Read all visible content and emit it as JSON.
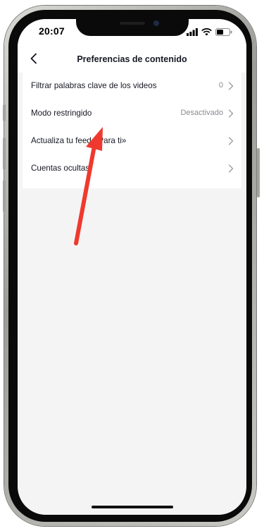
{
  "status_bar": {
    "time": "20:07",
    "icons": [
      "signal-bars-icon",
      "wifi-icon",
      "battery-icon"
    ]
  },
  "nav": {
    "back_icon": "chevron-left-icon",
    "title": "Preferencias de contenido"
  },
  "settings": {
    "items": [
      {
        "label": "Filtrar palabras clave de los videos",
        "value": "0"
      },
      {
        "label": "Modo restringido",
        "value": "Desactivado"
      },
      {
        "label": "Actualiza tu feed «Para ti»",
        "value": ""
      },
      {
        "label": "Cuentas ocultas",
        "value": ""
      }
    ]
  },
  "annotation": {
    "icon": "red-arrow-annotation",
    "color": "#f0392e"
  },
  "colors": {
    "text": "#161823",
    "secondary": "#8a8b91",
    "background": "#f4f4f4"
  }
}
